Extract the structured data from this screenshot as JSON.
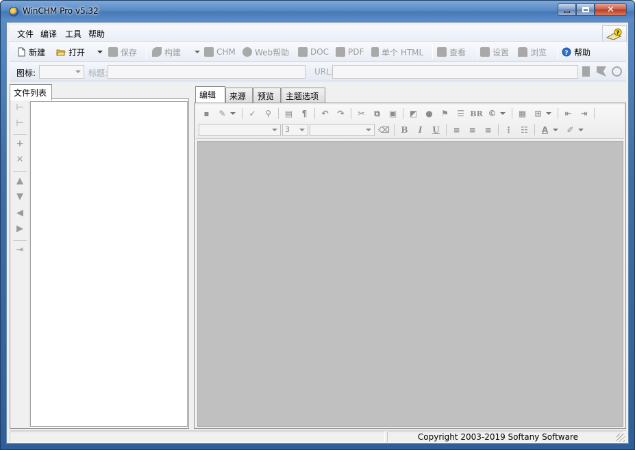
{
  "window": {
    "title": "WinCHM Pro v5.32"
  },
  "menu": {
    "items": [
      "文件",
      "编译",
      "工具",
      "帮助"
    ]
  },
  "toolbar": {
    "new": "新建",
    "open": "打开",
    "save": "保存",
    "build": "构建",
    "chm": "CHM",
    "webhelp": "Web帮助",
    "doc": "DOC",
    "pdf": "PDF",
    "single_html": "单个 HTML",
    "view": "查看",
    "settings": "设置",
    "browse": "浏览",
    "help": "帮助"
  },
  "props": {
    "icon_label": "图标:",
    "title_label": "标题:",
    "url_label": "URL:"
  },
  "left": {
    "tab": "文件列表"
  },
  "right": {
    "tabs": [
      "编辑",
      "来源",
      "预览",
      "主题选项"
    ]
  },
  "editor": {
    "font_size": "3"
  },
  "status": {
    "copyright": "Copyright 2003-2019 Softany Software"
  },
  "colors": {
    "title_gradient": "#5b8cc6",
    "editor_bg": "#c0c0c0",
    "disabled_text": "#9a9a9a"
  }
}
